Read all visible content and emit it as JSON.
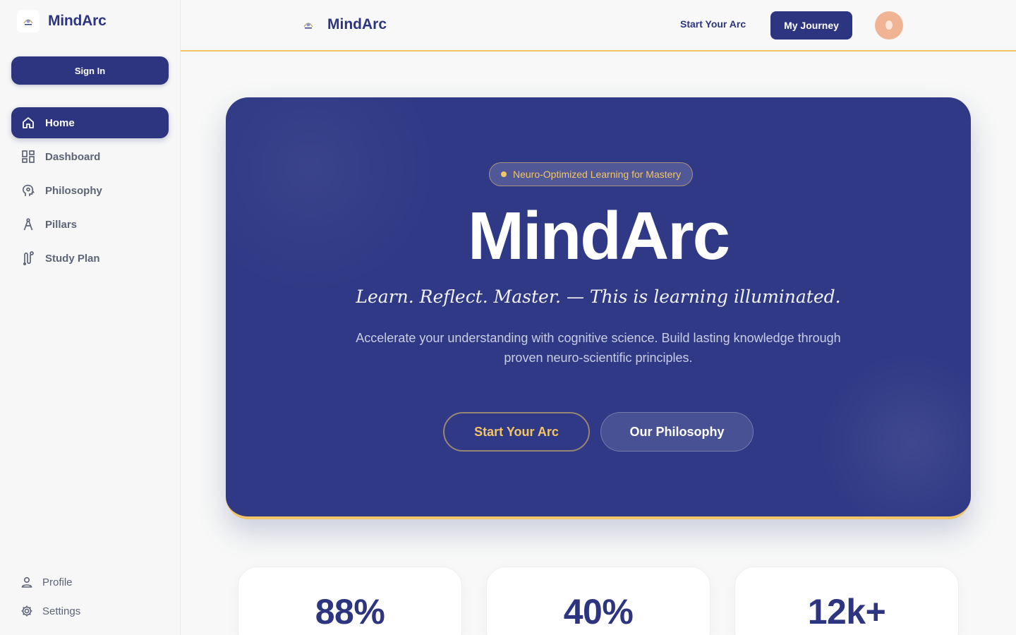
{
  "sidebar": {
    "brand_name": "MindArc",
    "sign_in_label": "Sign In",
    "nav": [
      {
        "label": "Home",
        "icon": "home-icon",
        "active": true
      },
      {
        "label": "Dashboard",
        "icon": "dashboard-icon"
      },
      {
        "label": "Philosophy",
        "icon": "brain-head-icon"
      },
      {
        "label": "Pillars",
        "icon": "compass-icon"
      },
      {
        "label": "Study Plan",
        "icon": "route-icon"
      }
    ],
    "bottom": [
      {
        "label": "Profile",
        "icon": "user-icon"
      },
      {
        "label": "Settings",
        "icon": "gear-icon"
      }
    ]
  },
  "topbar": {
    "brand_name": "MindArc",
    "start_link": "Start Your Arc",
    "journey_button": "My Journey",
    "avatar_icon": "avatar-icon"
  },
  "hero": {
    "badge": "Neuro-Optimized Learning for Mastery",
    "title": "MindArc",
    "tagline": "Learn. Reflect. Master. — This is learning illuminated.",
    "description": "Accelerate your understanding with cognitive science. Build lasting knowledge through proven neuro-scientific principles.",
    "primary_button": "Start Your Arc",
    "secondary_button": "Our Philosophy"
  },
  "stats": [
    "88%",
    "40%",
    "12k+"
  ],
  "colors": {
    "primary": "#2d3580",
    "accent": "#f2c566",
    "background": "#f7f8f7",
    "avatar": "#f0b394"
  }
}
